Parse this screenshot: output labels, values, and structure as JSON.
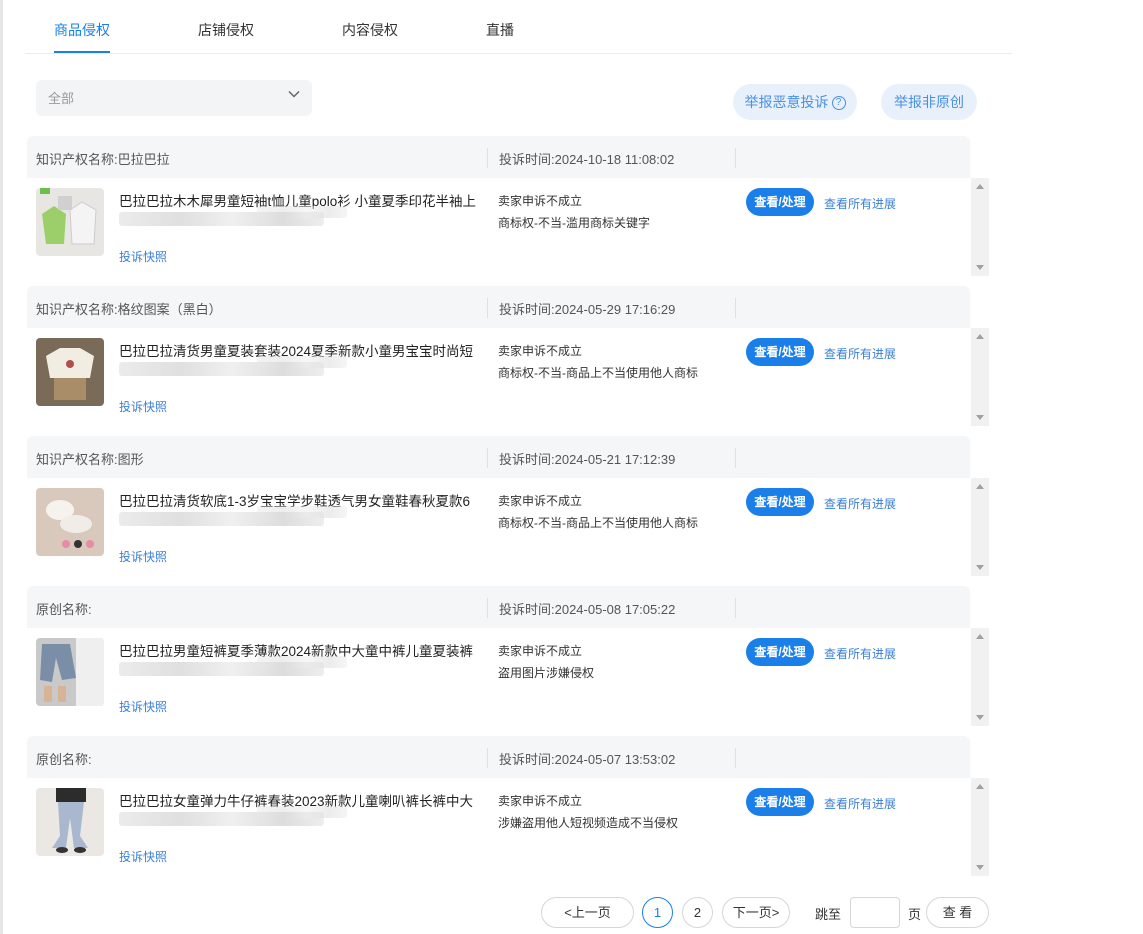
{
  "tabs": [
    {
      "label": "商品侵权",
      "active": true
    },
    {
      "label": "店铺侵权",
      "active": false
    },
    {
      "label": "内容侵权",
      "active": false
    },
    {
      "label": "直播",
      "active": false
    }
  ],
  "filter": {
    "selected": "全部",
    "icon": "chevron-down-icon"
  },
  "actions": {
    "report_malicious": "举报恶意投诉",
    "report_malicious_icon": "help-circle-icon",
    "report_non_original": "举报非原创"
  },
  "complaints": [
    {
      "name": "知识产权名称:巴拉巴拉",
      "time": "投诉时间:2024-10-18 11:08:02",
      "title": "巴拉巴拉木木犀男童短袖t恤儿童polo衫 小童夏季印花半袖上",
      "snapshot": "投诉快照",
      "status": "卖家申诉不成立",
      "reason": "商标权-不当-滥用商标关键字",
      "view_button": "查看/处理",
      "progress_link": "查看所有进展"
    },
    {
      "name": "知识产权名称:格纹图案（黑白）",
      "time": "投诉时间:2024-05-29 17:16:29",
      "title": "巴拉巴拉清货男童夏装套装2024夏季新款小童男宝宝时尚短",
      "snapshot": "投诉快照",
      "status": "卖家申诉不成立",
      "reason": "商标权-不当-商品上不当使用他人商标",
      "view_button": "查看/处理",
      "progress_link": "查看所有进展"
    },
    {
      "name": "知识产权名称:图形",
      "time": "投诉时间:2024-05-21 17:12:39",
      "title": "巴拉巴拉清货软底1-3岁宝宝学步鞋透气男女童鞋春秋夏款6",
      "snapshot": "投诉快照",
      "status": "卖家申诉不成立",
      "reason": "商标权-不当-商品上不当使用他人商标",
      "view_button": "查看/处理",
      "progress_link": "查看所有进展"
    },
    {
      "name": "原创名称:",
      "time": "投诉时间:2024-05-08 17:05:22",
      "title": "巴拉巴拉男童短裤夏季薄款2024新款中大童中裤儿童夏装裤",
      "snapshot": "投诉快照",
      "status": "卖家申诉不成立",
      "reason": "盗用图片涉嫌侵权",
      "view_button": "查看/处理",
      "progress_link": "查看所有进展"
    },
    {
      "name": "原创名称:",
      "time": "投诉时间:2024-05-07 13:53:02",
      "title": "巴拉巴拉女童弹力牛仔裤春装2023新款儿童喇叭裤长裤中大",
      "snapshot": "投诉快照",
      "status": "卖家申诉不成立",
      "reason": "涉嫌盗用他人短视频造成不当侵权",
      "view_button": "查看/处理",
      "progress_link": "查看所有进展"
    }
  ],
  "pagination": {
    "prev": "<上一页",
    "pages": [
      "1",
      "2"
    ],
    "current": "1",
    "next": "下一页>",
    "jump_to": "跳至",
    "page_unit": "页",
    "go": "查 看"
  }
}
